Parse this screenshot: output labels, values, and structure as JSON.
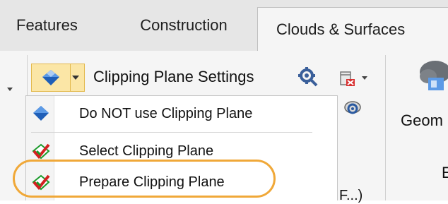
{
  "tabs": {
    "features": "Features",
    "construction": "Construction",
    "clouds_surfaces": "Clouds & Surfaces"
  },
  "ribbon": {
    "clipping_settings_label": "Clipping Plane Settings",
    "geometry_label": "Geom",
    "group_label_fragment": "E",
    "bottom_text_fragment": "l F...)"
  },
  "dropdown": {
    "items": [
      {
        "label": "Do NOT use Clipping Plane",
        "icon": "clipping-plane-icon"
      },
      {
        "label": "Select Clipping Plane",
        "icon": "clipping-plane-check-icon"
      },
      {
        "label": "Prepare Clipping Plane",
        "icon": "clipping-plane-check-icon"
      }
    ],
    "highlighted_item": "Prepare Clipping Plane"
  },
  "colors": {
    "tab_bar": "#e6e6e6",
    "ribbon": "#f5f5f5",
    "split_button_hover": "#fbe6a6",
    "highlight_ring": "#f0a838",
    "plane_blue": "#1f5fb8",
    "check_red": "#d42020",
    "check_green": "#1a9a2a"
  }
}
